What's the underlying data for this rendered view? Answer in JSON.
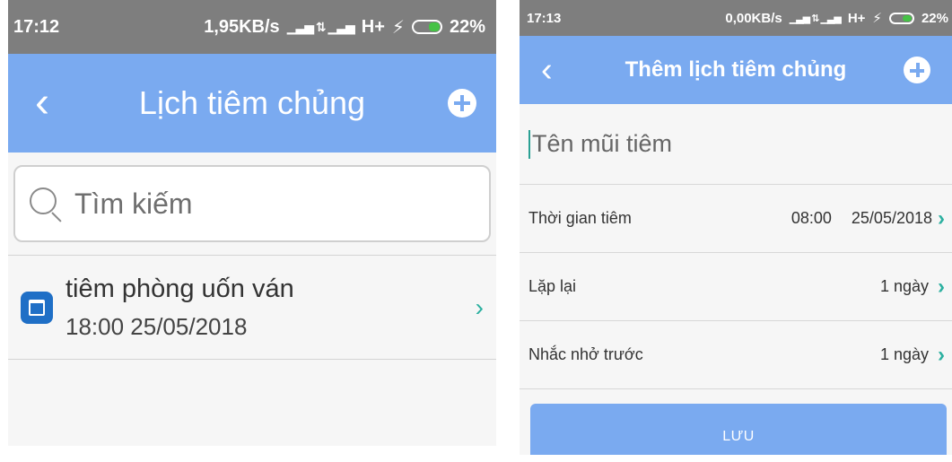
{
  "screen1": {
    "statusbar": {
      "time": "17:12",
      "speed": "1,95KB/s",
      "network": "H+",
      "battery": "22%"
    },
    "appbar": {
      "back": "‹",
      "title": "Lịch tiêm chủng"
    },
    "search": {
      "placeholder": "Tìm kiếm"
    },
    "items": [
      {
        "title": "tiêm phòng uốn ván",
        "datetime": "18:00 25/05/2018"
      }
    ]
  },
  "screen2": {
    "statusbar": {
      "time": "17:13",
      "speed": "0,00KB/s",
      "network": "H+",
      "battery": "22%"
    },
    "appbar": {
      "back": "‹",
      "title": "Thêm lịch tiêm chủng"
    },
    "name_field": {
      "placeholder": "Tên mũi tiêm"
    },
    "rows": [
      {
        "label": "Thời gian tiêm",
        "time": "08:00",
        "value": "25/05/2018"
      },
      {
        "label": "Lặp lại",
        "value": "1 ngày"
      },
      {
        "label": "Nhắc nhở trước",
        "value": "1 ngày"
      }
    ],
    "save_label": "LƯU"
  },
  "colors": {
    "accent": "#7aaaf0",
    "statusbar": "#7e7e7e",
    "chevron": "#2cb0a0"
  },
  "icons": [
    "back-icon",
    "plus-circle-icon",
    "search-icon",
    "calendar-icon",
    "chevron-right-icon",
    "battery-icon",
    "signal-icon"
  ]
}
